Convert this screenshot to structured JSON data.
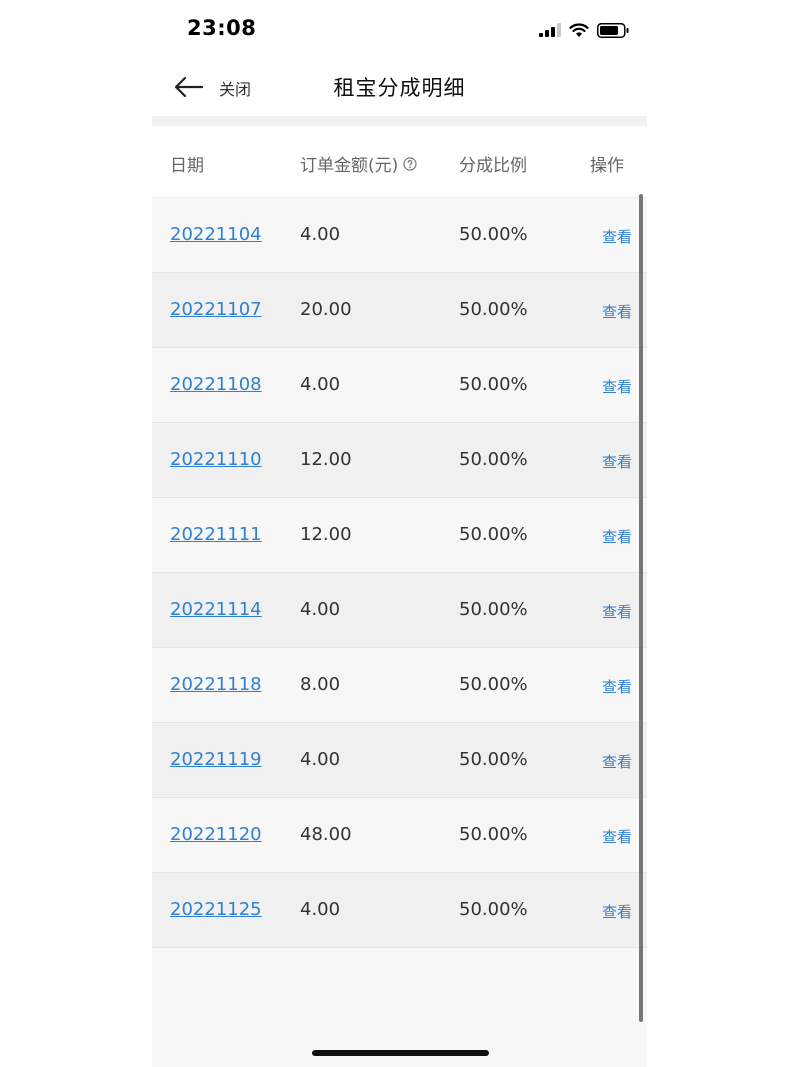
{
  "status_bar": {
    "time": "23:08"
  },
  "nav": {
    "close_label": "关闭",
    "title": "租宝分成明细"
  },
  "table": {
    "headers": {
      "date": "日期",
      "amount": "订单金额(元)",
      "ratio": "分成比例",
      "action": "操作"
    },
    "rows": [
      {
        "date": "20221104",
        "amount": "4.00",
        "ratio": "50.00%",
        "action": "查看"
      },
      {
        "date": "20221107",
        "amount": "20.00",
        "ratio": "50.00%",
        "action": "查看"
      },
      {
        "date": "20221108",
        "amount": "4.00",
        "ratio": "50.00%",
        "action": "查看"
      },
      {
        "date": "20221110",
        "amount": "12.00",
        "ratio": "50.00%",
        "action": "查看"
      },
      {
        "date": "20221111",
        "amount": "12.00",
        "ratio": "50.00%",
        "action": "查看"
      },
      {
        "date": "20221114",
        "amount": "4.00",
        "ratio": "50.00%",
        "action": "查看"
      },
      {
        "date": "20221118",
        "amount": "8.00",
        "ratio": "50.00%",
        "action": "查看"
      },
      {
        "date": "20221119",
        "amount": "4.00",
        "ratio": "50.00%",
        "action": "查看"
      },
      {
        "date": "20221120",
        "amount": "48.00",
        "ratio": "50.00%",
        "action": "查看"
      },
      {
        "date": "20221125",
        "amount": "4.00",
        "ratio": "50.00%",
        "action": "查看"
      }
    ]
  },
  "colors": {
    "link": "#2f80d1",
    "text": "#333333",
    "header_text": "#666666"
  },
  "icons": {
    "back": "arrow-left-icon",
    "help": "question-circle-icon",
    "signal": "signal-icon",
    "wifi": "wifi-icon",
    "battery": "battery-icon"
  }
}
